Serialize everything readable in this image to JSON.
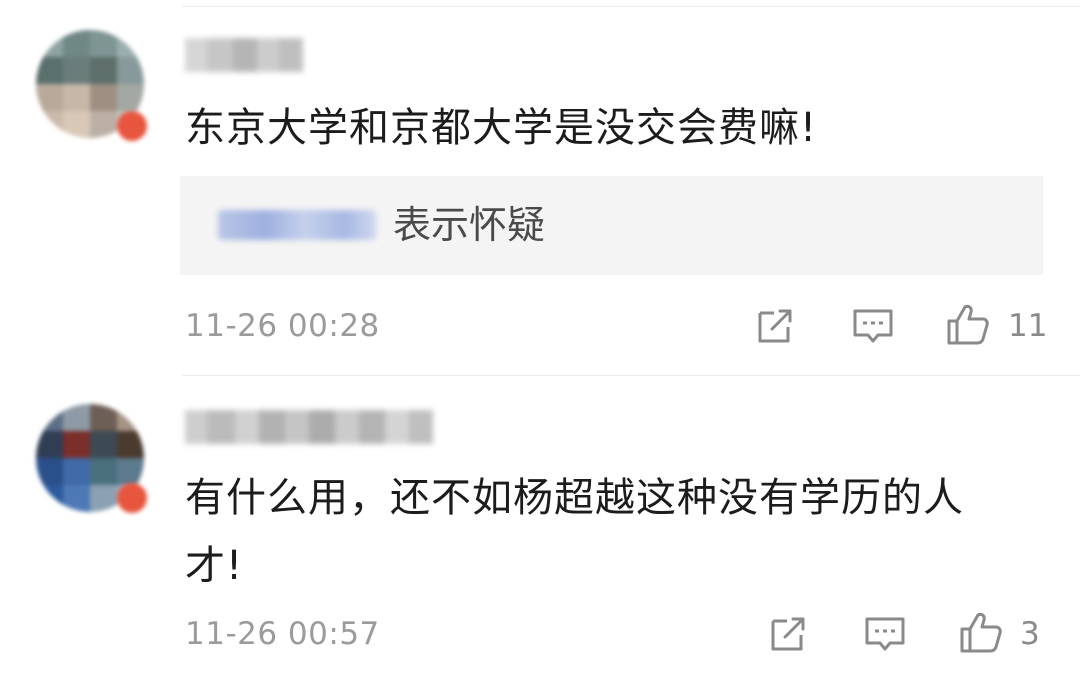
{
  "comments": [
    {
      "text": "东京大学和京都大学是没交会费嘛!",
      "reply": {
        "text": "表示怀疑"
      },
      "time": "11-26 00:28",
      "likes": "11",
      "icons": [
        "share-icon",
        "comment-icon",
        "like-icon"
      ]
    },
    {
      "text_line1": "有什么用，还不如杨超越这种没有学历的人",
      "text_line2": "才!",
      "time": "11-26 00:57",
      "likes": "3",
      "icons": [
        "share-icon",
        "comment-icon",
        "like-icon"
      ]
    }
  ],
  "colors": {
    "text": "#1c1c1c",
    "meta": "#9b9b9b",
    "reply_bg": "#f4f4f4",
    "reply_user": "#a7b8e2",
    "badge": "#e8553f"
  }
}
